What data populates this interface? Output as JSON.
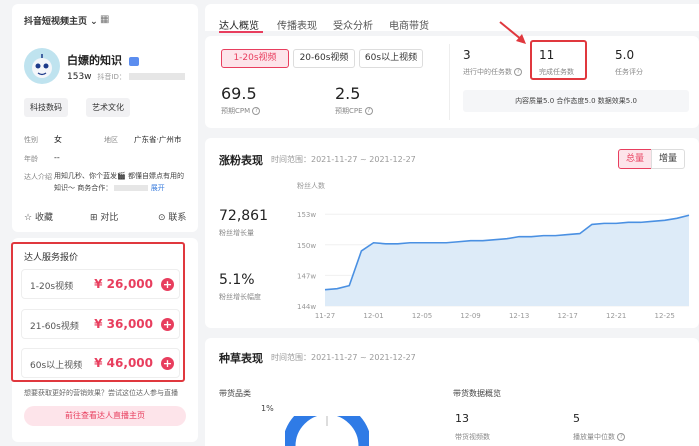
{
  "header": {
    "dropdown_label": "抖音短视频主页",
    "grid_icon": "grid-icon"
  },
  "profile": {
    "name": "白嫖的知识",
    "fans": "153w",
    "id_label": "抖音ID：",
    "tags": [
      "科技数码",
      "艺术文化"
    ],
    "gender_label": "性别",
    "gender": "女",
    "region_label": "地区",
    "region": "广东省·广州市",
    "age_label": "年龄",
    "age": "--",
    "intro_label": "达人介绍",
    "intro_line1": "用知几秒、你个蓝发🎬 都懂自嫖点有用的",
    "intro_line2": "知识～ 商务合作：",
    "expand": "展开",
    "actions": {
      "favorite": "收藏",
      "compare": "对比",
      "contact": "联系"
    }
  },
  "pricing": {
    "title": "达人服务报价",
    "rows": [
      {
        "label": "1-20s视频",
        "price": "¥ 26,000"
      },
      {
        "label": "21-60s视频",
        "price": "¥ 36,000"
      },
      {
        "label": "60s以上视频",
        "price": "¥ 46,000"
      }
    ],
    "hint": "想要获取更好的营销效果？尝试这位达人参与直播",
    "cta": "前往查看达人直播主页"
  },
  "tabs": [
    "达人概览",
    "传播表现",
    "受众分析",
    "电商带货"
  ],
  "video_tabs": [
    "1-20s视频",
    "20-60s视频",
    "60s以上视频"
  ],
  "metrics": {
    "cpm_value": "69.5",
    "cpm_label": "预期CPM",
    "cpe_value": "2.5",
    "cpe_label": "预期CPE"
  },
  "tasks": {
    "in_progress_value": "3",
    "in_progress_label": "进行中的任务数",
    "completed_value": "11",
    "completed_label": "完成任务数",
    "rating_value": "5.0",
    "rating_label": "任务评分",
    "summary": "内容质量5.0  合作态度5.0  数据效果5.0"
  },
  "growth": {
    "title": "涨粉表现",
    "range": "时间范围：2021-11-27 ~ 2021-12-27",
    "toggle": [
      "总量",
      "增量"
    ],
    "fans_value": "72,861",
    "fans_label": "粉丝增长量",
    "rate_value": "5.1%",
    "rate_label": "粉丝增长幅度"
  },
  "chart_data": {
    "type": "area",
    "ylabel": "粉丝人数",
    "y_ticks": [
      "144w",
      "147w",
      "150w",
      "153w"
    ],
    "ylim": [
      144,
      154
    ],
    "x_ticks": [
      "11-27",
      "12-01",
      "12-05",
      "12-09",
      "12-13",
      "12-17",
      "12-21",
      "12-25"
    ],
    "x": [
      "11-27",
      "11-28",
      "11-29",
      "11-30",
      "12-01",
      "12-02",
      "12-03",
      "12-04",
      "12-05",
      "12-06",
      "12-07",
      "12-08",
      "12-09",
      "12-10",
      "12-11",
      "12-12",
      "12-13",
      "12-14",
      "12-15",
      "12-16",
      "12-17",
      "12-18",
      "12-19",
      "12-20",
      "12-21",
      "12-22",
      "12-23",
      "12-24",
      "12-25",
      "12-26",
      "12-27"
    ],
    "series": [
      {
        "values": [
          145.6,
          145.7,
          146.0,
          149.4,
          150.2,
          150.1,
          150.1,
          150.2,
          150.2,
          150.2,
          150.2,
          150.3,
          150.4,
          150.4,
          150.5,
          150.6,
          150.8,
          150.8,
          150.9,
          150.9,
          151.0,
          151.1,
          152.0,
          152.1,
          152.1,
          152.2,
          152.2,
          152.3,
          152.4,
          152.6,
          152.9
        ]
      }
    ],
    "color": "#4a90e2",
    "fill": "#ddebf8"
  },
  "seeding": {
    "title": "种草表现",
    "range": "时间范围：2021-11-27 ~ 2021-12-27",
    "category_label": "带货品类",
    "donut_pct": "1%",
    "overview_label": "带货数据概览",
    "goods_value": "13",
    "goods_label": "带货视频数",
    "play_value": "5",
    "play_label": "播放量中位数"
  }
}
